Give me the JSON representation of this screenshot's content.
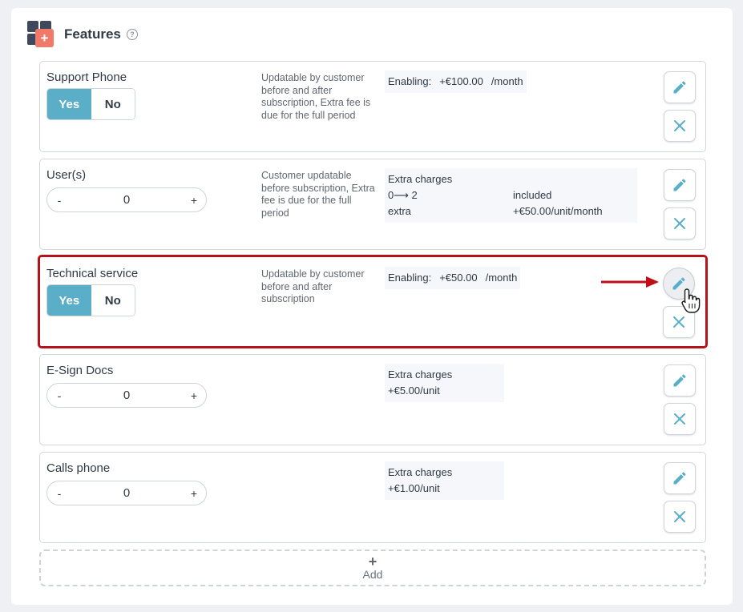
{
  "header": {
    "title": "Features",
    "help_icon": "?"
  },
  "colors": {
    "accent": "#5aaec8",
    "highlight": "#b5121b",
    "logo_dark": "#3e4a5c",
    "logo_plus": "#f07a6a"
  },
  "features": [
    {
      "name": "Support Phone",
      "control": "toggle",
      "yes_label": "Yes",
      "no_label": "No",
      "selected": "Yes",
      "description": "Updatable by customer before and after subscription, Extra fee is due for the full period",
      "pricing": {
        "label": "Enabling:",
        "amount": "+€100.00",
        "period": "/month"
      }
    },
    {
      "name": "User(s)",
      "control": "stepper",
      "minus": "-",
      "value": "0",
      "plus": "+",
      "description": "Customer updatable before subscription, Extra fee is due for the full period",
      "pricing": {
        "title": "Extra charges",
        "rows": [
          {
            "a": "0⟶ 2",
            "b": "included"
          },
          {
            "a": "extra",
            "b": "+€50.00/unit/month"
          }
        ]
      }
    },
    {
      "name": "Technical service",
      "control": "toggle",
      "yes_label": "Yes",
      "no_label": "No",
      "selected": "Yes",
      "description": "Updatable by customer before and after subscription",
      "pricing": {
        "label": "Enabling:",
        "amount": "+€50.00",
        "period": "/month"
      }
    },
    {
      "name": "E-Sign Docs",
      "control": "stepper",
      "minus": "-",
      "value": "0",
      "plus": "+",
      "description": "",
      "pricing": {
        "title": "Extra charges",
        "line": "+€5.00/unit"
      }
    },
    {
      "name": "Calls phone",
      "control": "stepper",
      "minus": "-",
      "value": "0",
      "plus": "+",
      "description": "",
      "pricing": {
        "title": "Extra charges",
        "line": "+€1.00/unit"
      }
    }
  ],
  "add": {
    "plus": "+",
    "label": "Add"
  },
  "icons": {
    "edit": "pencil-icon",
    "delete": "close-x-icon",
    "logo": "features-logo-icon"
  }
}
